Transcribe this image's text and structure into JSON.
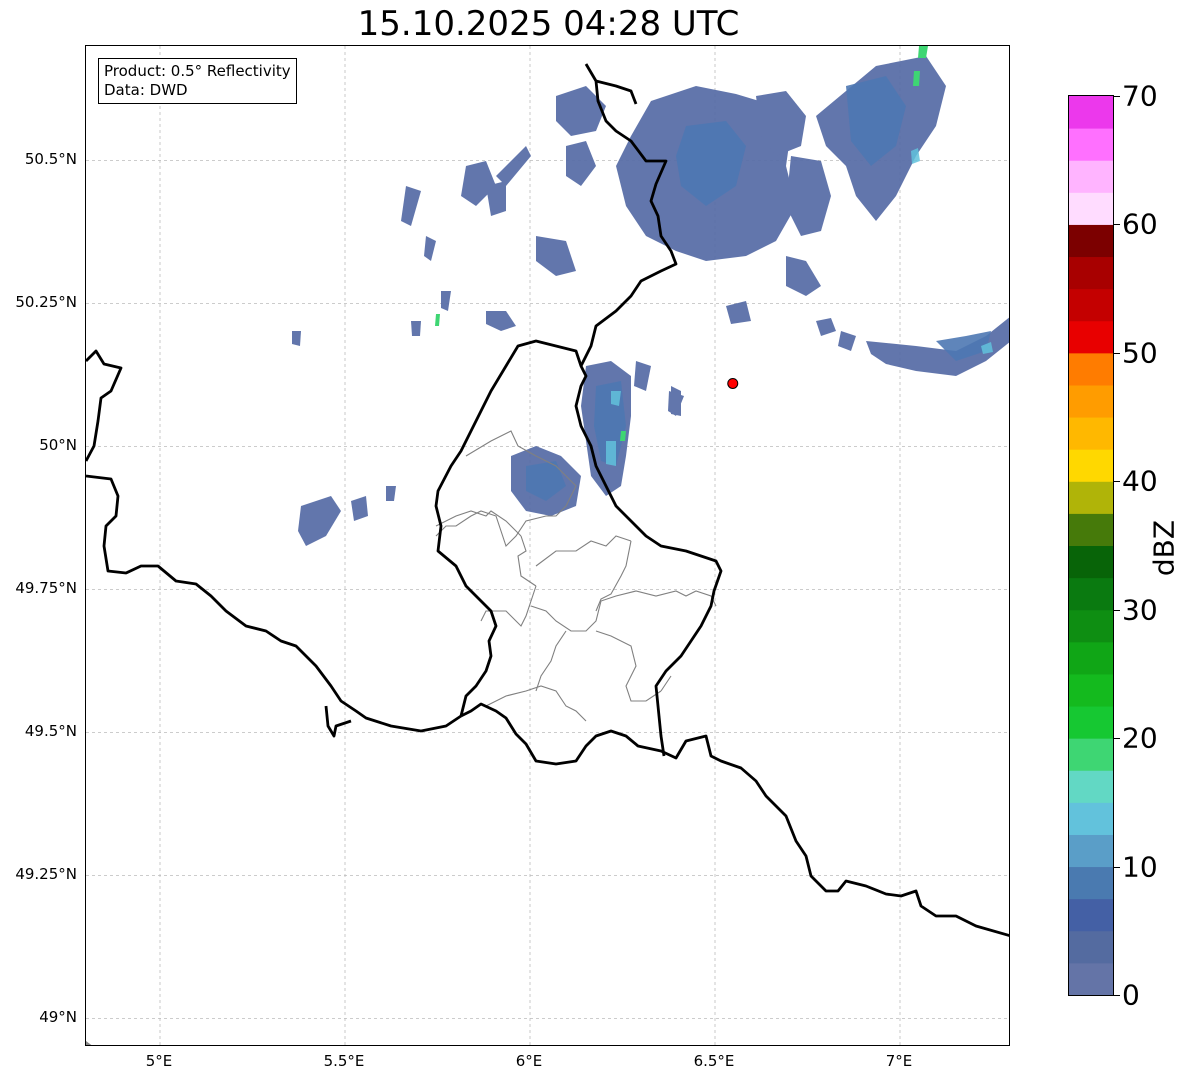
{
  "title": "15.10.2025 04:28 UTC",
  "infobox": {
    "product": "Product: 0.5° Reflectivity",
    "data": "Data: DWD"
  },
  "map": {
    "lon_min": 4.8,
    "lon_max": 7.3,
    "lat_min": 48.95,
    "lat_max": 50.7,
    "lat_ticks": [
      {
        "value": 50.5,
        "label": "50.5°N"
      },
      {
        "value": 50.25,
        "label": "50.25°N"
      },
      {
        "value": 50.0,
        "label": "50°N"
      },
      {
        "value": 49.75,
        "label": "49.75°N"
      },
      {
        "value": 49.5,
        "label": "49.5°N"
      },
      {
        "value": 49.25,
        "label": "49.25°N"
      },
      {
        "value": 49.0,
        "label": "49°N"
      }
    ],
    "lon_ticks": [
      {
        "value": 5.0,
        "label": "5°E"
      },
      {
        "value": 5.5,
        "label": "5.5°E"
      },
      {
        "value": 6.0,
        "label": "6°E"
      },
      {
        "value": 6.5,
        "label": "6.5°E"
      },
      {
        "value": 7.0,
        "label": "7°E"
      }
    ],
    "radar_site": {
      "lon": 6.548,
      "lat": 50.11,
      "color": "#ff0000"
    },
    "grid": true,
    "border_color": "#000000",
    "district_color": "#808080"
  },
  "colorbar": {
    "label": "dBZ",
    "min": 0,
    "max": 70,
    "ticks": [
      {
        "value": 0,
        "label": "0"
      },
      {
        "value": 10,
        "label": "10"
      },
      {
        "value": 20,
        "label": "20"
      },
      {
        "value": 30,
        "label": "30"
      },
      {
        "value": 40,
        "label": "40"
      },
      {
        "value": 50,
        "label": "50"
      },
      {
        "value": 60,
        "label": "60"
      },
      {
        "value": 70,
        "label": "70"
      }
    ],
    "colors": [
      "#6474a7",
      "#546ba0",
      "#4460a5",
      "#4a7ab0",
      "#5a9ec8",
      "#62c2dc",
      "#62d8c4",
      "#3ed673",
      "#16c832",
      "#14ba1e",
      "#10a616",
      "#0e8e12",
      "#0a7a10",
      "#086408",
      "#467a0a",
      "#b0b408",
      "#ffd800",
      "#ffb800",
      "#ff9c00",
      "#ff7c00",
      "#e80000",
      "#c40000",
      "#a80000",
      "#7c0000",
      "#ffdcff",
      "#ffb4ff",
      "#ff70ff",
      "#ec38ec"
    ]
  }
}
